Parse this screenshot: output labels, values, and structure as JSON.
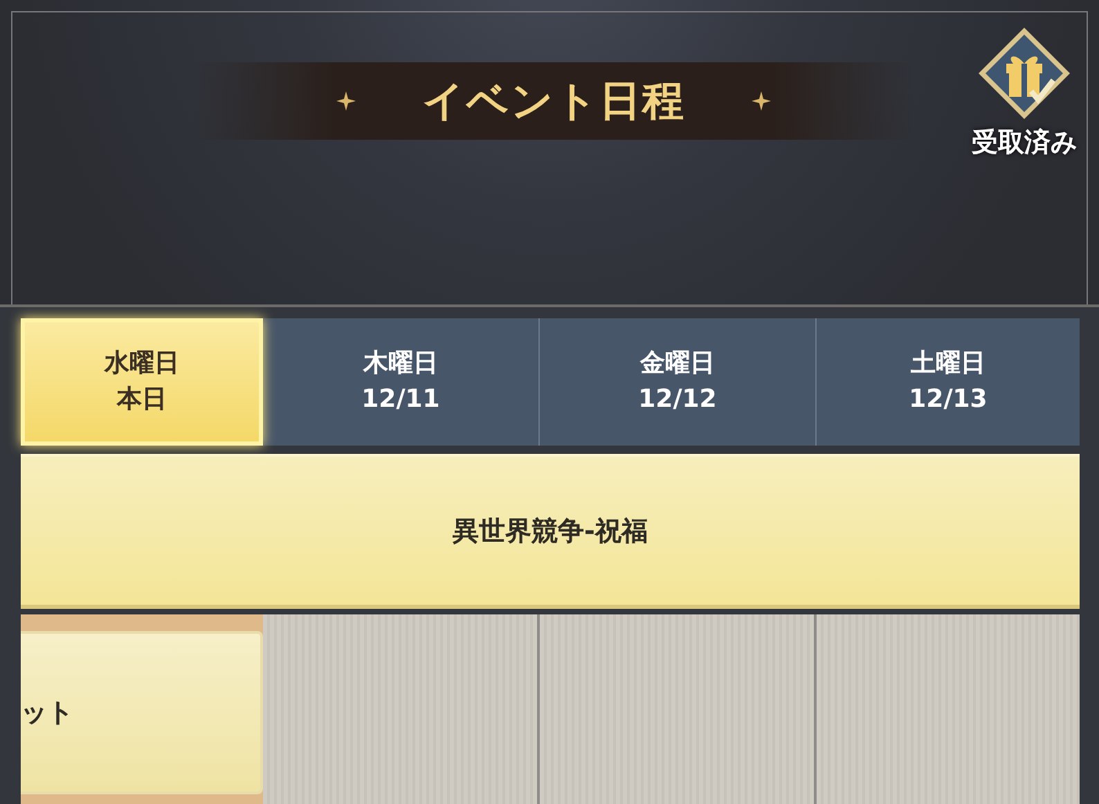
{
  "title": "イベント日程",
  "reward_badge": {
    "label": "受取済み",
    "claimed": true
  },
  "days": [
    {
      "weekday": "水曜日",
      "date": "本日",
      "selected": true
    },
    {
      "weekday": "木曜日",
      "date": "12/11",
      "selected": false
    },
    {
      "weekday": "金曜日",
      "date": "12/12",
      "selected": false
    },
    {
      "weekday": "土曜日",
      "date": "12/13",
      "selected": false
    }
  ],
  "events": [
    {
      "name": "異世界競争-祝福"
    }
  ],
  "schedule_row": [
    {
      "kind": "event",
      "text": "ット"
    },
    {
      "kind": "empty"
    },
    {
      "kind": "empty"
    },
    {
      "kind": "empty"
    }
  ]
}
